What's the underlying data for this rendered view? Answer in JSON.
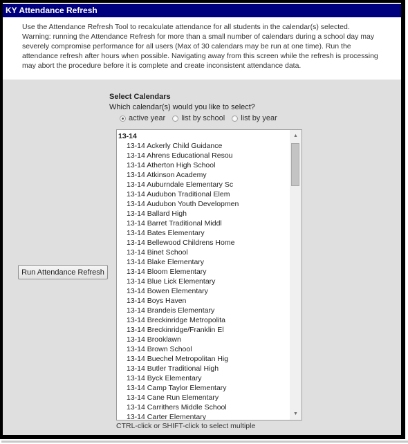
{
  "header": {
    "title": "KY Attendance Refresh"
  },
  "intro": {
    "lines": [
      "Use the Attendance Refresh Tool to recalculate attendance for all students in the calendar(s) selected.",
      "Warning: running the Attendance Refresh for more than a small number of calendars during a school day may",
      "severely compromise performance for all users (Max of 30 calendars may be run at one time). Run the",
      "attendance refresh after hours when possible. Navigating away from this screen while the refresh is processing",
      "may abort the procedure before it is complete and create inconsistent attendance data."
    ]
  },
  "actions": {
    "run_label": "Run Attendance Refresh"
  },
  "select_calendars": {
    "title": "Select Calendars",
    "question": "Which calendar(s) would you like to select?",
    "radios": [
      {
        "label": "active year",
        "checked": true
      },
      {
        "label": "list by school",
        "checked": false
      },
      {
        "label": "list by year",
        "checked": false
      }
    ],
    "group_label": "13-14",
    "options": [
      "13-14 Ackerly Child Guidance",
      "13-14 Ahrens Educational Resou",
      "13-14 Atherton High School",
      "13-14 Atkinson Academy",
      "13-14 Auburndale Elementary Sc",
      "13-14 Audubon Traditional Elem",
      "13-14 Audubon Youth Developmen",
      "13-14 Ballard High",
      "13-14 Barret Traditional Middl",
      "13-14 Bates Elementary",
      "13-14 Bellewood Childrens Home",
      "13-14 Binet School",
      "13-14 Blake Elementary",
      "13-14 Bloom Elementary",
      "13-14 Blue Lick Elementary",
      "13-14 Bowen Elementary",
      "13-14 Boys Haven",
      "13-14 Brandeis Elementary",
      "13-14 Breckinridge Metropolita",
      "13-14 Breckinridge/Franklin El",
      "13-14 Brooklawn",
      "13-14 Brown School",
      "13-14 Buechel Metropolitan Hig",
      "13-14 Butler Traditional High",
      "13-14 Byck Elementary",
      "13-14 Camp Taylor Elementary",
      "13-14 Cane Run Elementary",
      "13-14 Carrithers Middle School",
      "13-14 Carter Elementary"
    ],
    "hint": "CTRL-click or SHIFT-click to select multiple"
  },
  "icons": {
    "scroll_up": "▲",
    "scroll_down": "▼"
  }
}
